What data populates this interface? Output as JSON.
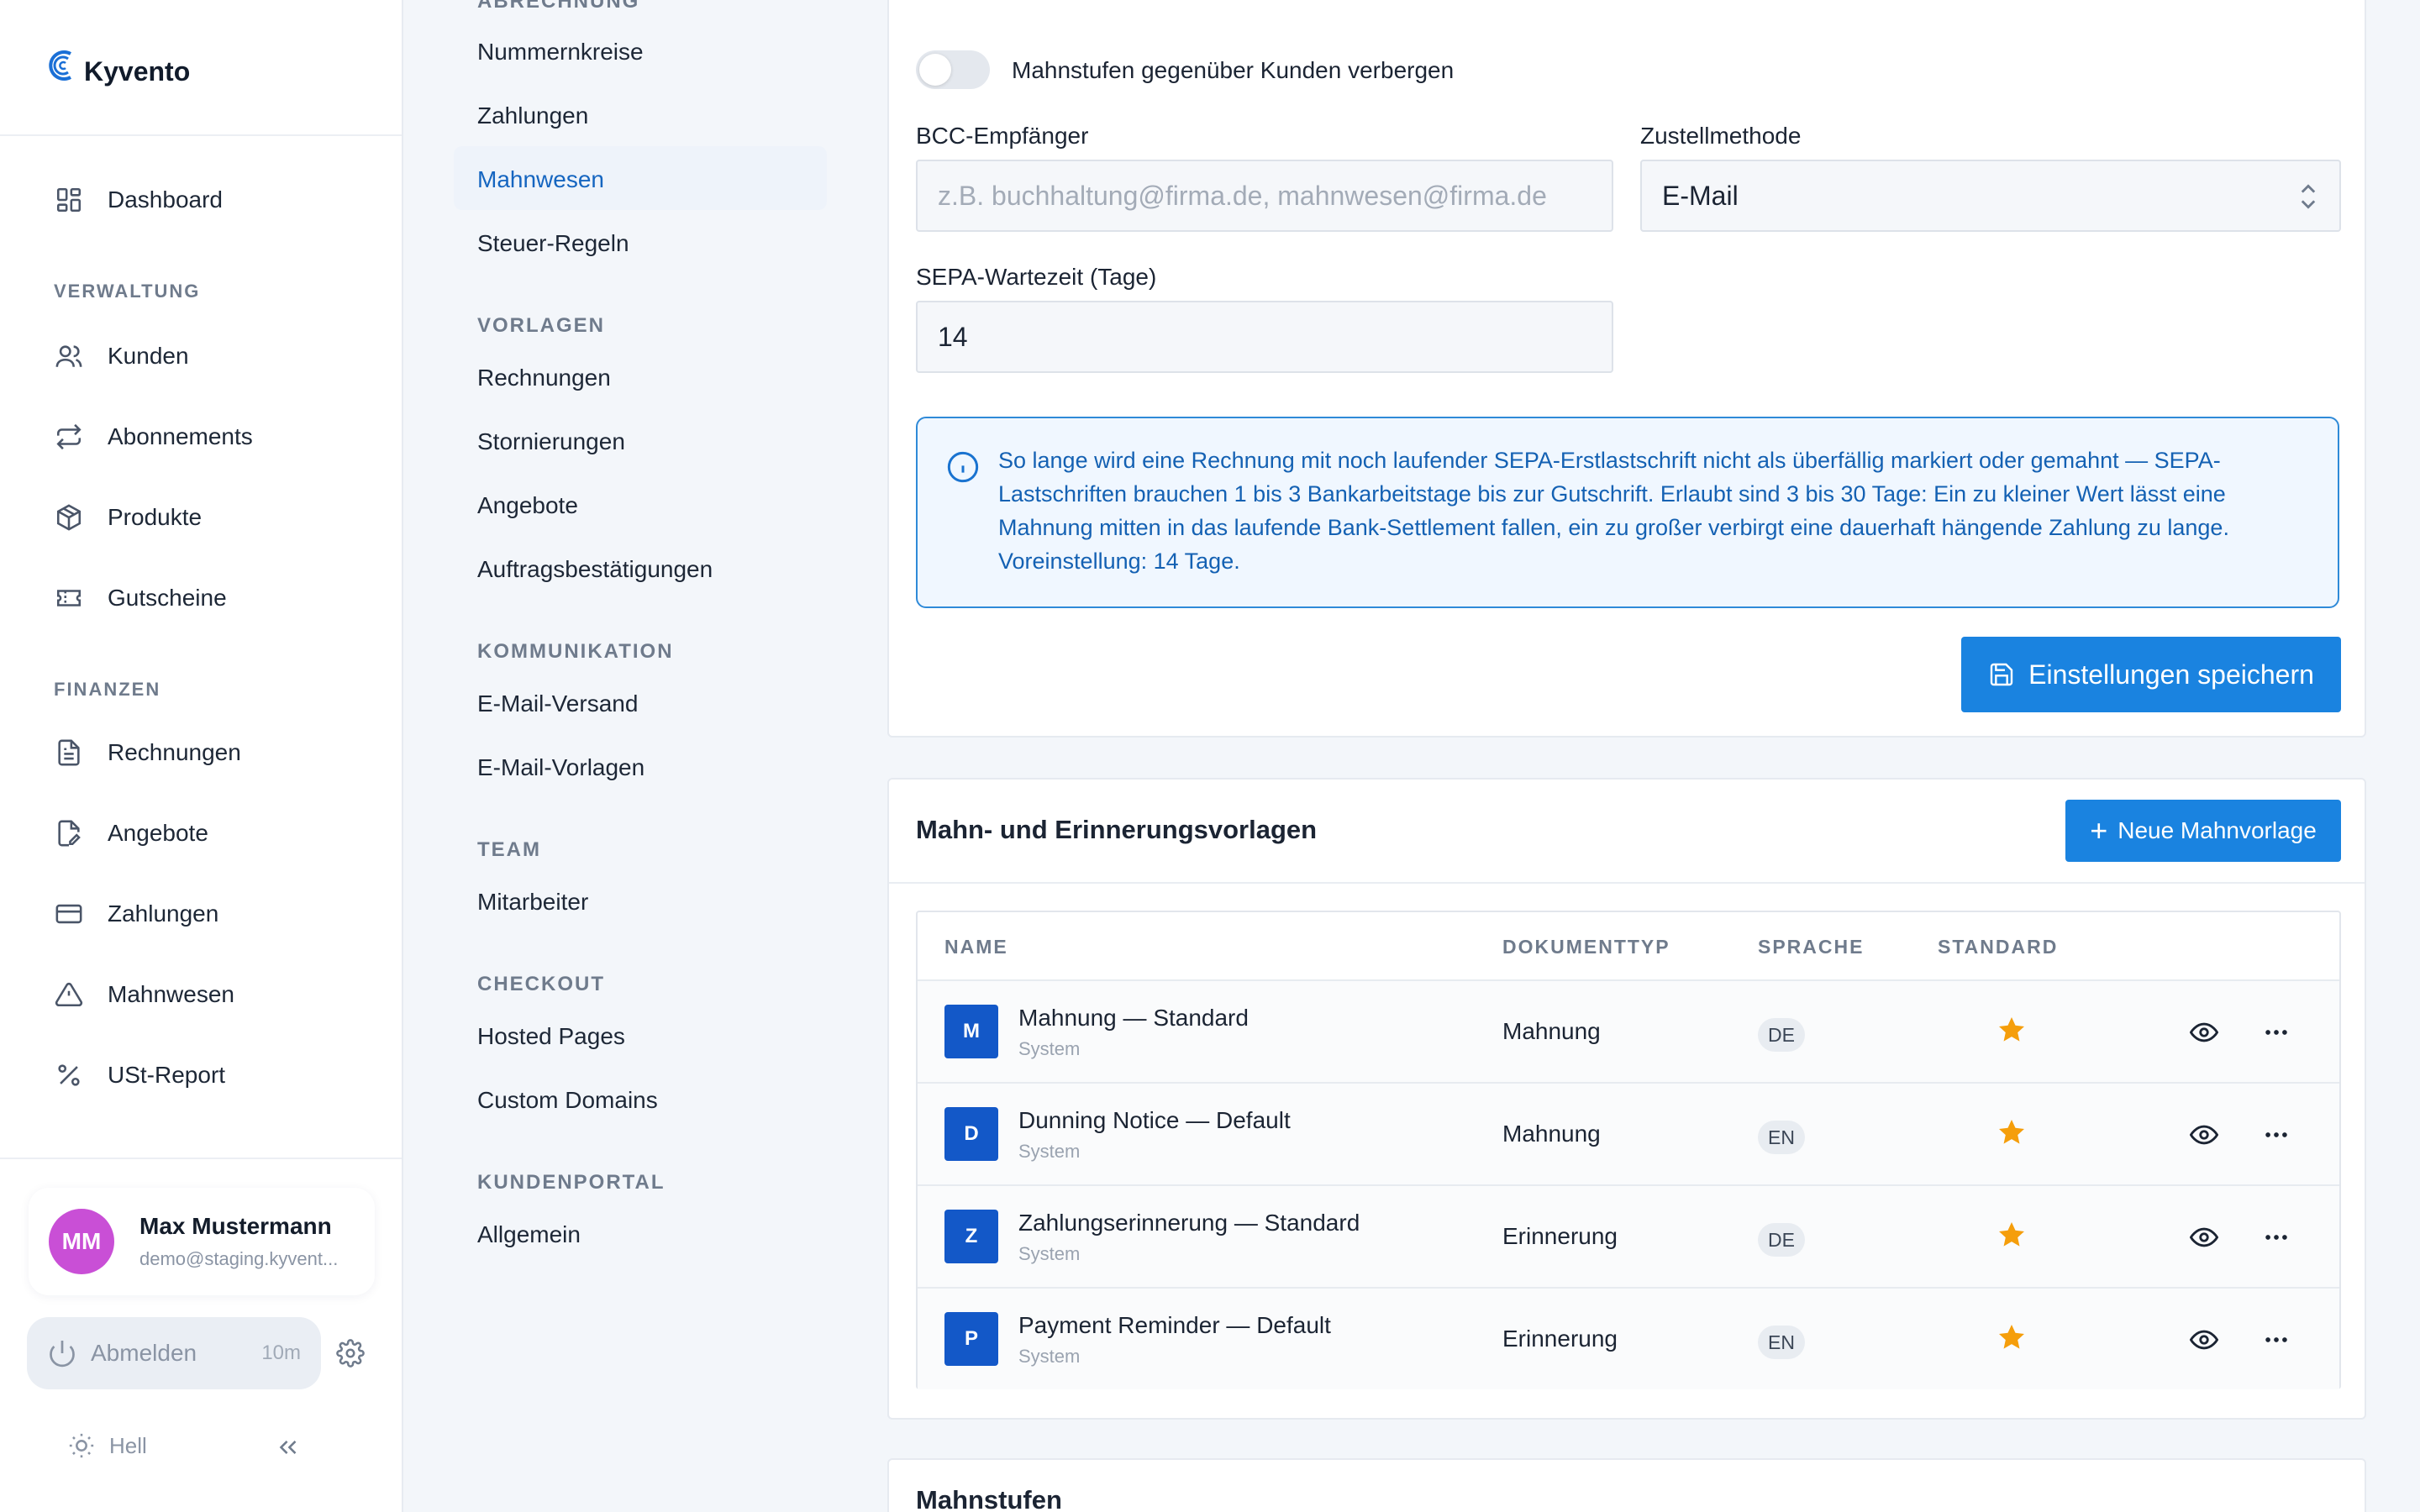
{
  "brand": {
    "name": "Kyvento"
  },
  "sidebar": {
    "dashboard": "Dashboard",
    "sections": {
      "verwaltung": "VERWALTUNG",
      "finanzen": "FINANZEN"
    },
    "verwaltung_items": [
      "Kunden",
      "Abonnements",
      "Produkte",
      "Gutscheine"
    ],
    "finanzen_items": [
      "Rechnungen",
      "Angebote",
      "Zahlungen",
      "Mahnwesen",
      "USt-Report"
    ]
  },
  "user": {
    "initials": "MM",
    "name": "Max Mustermann",
    "email": "demo@staging.kyvent...",
    "logout_label": "Abmelden",
    "session_timer": "10m",
    "theme_label": "Hell"
  },
  "subnav": {
    "partial_section": "ABRECHNUNG",
    "abrechnung": [
      "Nummernkreise",
      "Zahlungen",
      "Mahnwesen",
      "Steuer-Regeln"
    ],
    "active": "Mahnwesen",
    "vorlagen_label": "VORLAGEN",
    "vorlagen": [
      "Rechnungen",
      "Stornierungen",
      "Angebote",
      "Auftragsbestätigungen"
    ],
    "kommunikation_label": "KOMMUNIKATION",
    "kommunikation": [
      "E-Mail-Versand",
      "E-Mail-Vorlagen"
    ],
    "team_label": "TEAM",
    "team": [
      "Mitarbeiter"
    ],
    "checkout_label": "CHECKOUT",
    "checkout": [
      "Hosted Pages",
      "Custom Domains"
    ],
    "kundenportal_label": "KUNDENPORTAL",
    "kundenportal": [
      "Allgemein"
    ]
  },
  "settings": {
    "toggle_label": "Mahnstufen gegenüber Kunden verbergen",
    "toggle_on": false,
    "bcc_label": "BCC-Empfänger",
    "bcc_placeholder": "z.B. buchhaltung@firma.de, mahnwesen@firma.de",
    "delivery_label": "Zustellmethode",
    "delivery_value": "E-Mail",
    "sepa_label": "SEPA-Wartezeit (Tage)",
    "sepa_value": "14",
    "info_text": "So lange wird eine Rechnung mit noch laufender SEPA-Erstlastschrift nicht als überfällig markiert oder gemahnt — SEPA-Lastschriften brauchen 1 bis 3 Bankarbeitstage bis zur Gutschrift. Erlaubt sind 3 bis 30 Tage: Ein zu kleiner Wert lässt eine Mahnung mitten in das laufende Bank-Settlement fallen, ein zu großer verbirgt eine dauerhaft hängende Zahlung zu lange. Voreinstellung: 14 Tage.",
    "save_label": "Einstellungen speichern"
  },
  "templates": {
    "title": "Mahn- und Erinnerungsvorlagen",
    "new_label": "Neue Mahnvorlage",
    "columns": {
      "name": "NAME",
      "doctype": "DOKUMENTTYP",
      "language": "SPRACHE",
      "default": "STANDARD"
    },
    "rows": [
      {
        "initial": "M",
        "name": "Mahnung — Standard",
        "source": "System",
        "doctype": "Mahnung",
        "language": "DE",
        "is_default": true
      },
      {
        "initial": "D",
        "name": "Dunning Notice — Default",
        "source": "System",
        "doctype": "Mahnung",
        "language": "EN",
        "is_default": true
      },
      {
        "initial": "Z",
        "name": "Zahlungserinnerung — Standard",
        "source": "System",
        "doctype": "Erinnerung",
        "language": "DE",
        "is_default": true
      },
      {
        "initial": "P",
        "name": "Payment Reminder — Default",
        "source": "System",
        "doctype": "Erinnerung",
        "language": "EN",
        "is_default": true
      }
    ]
  },
  "steps": {
    "title": "Mahnstufen"
  },
  "colors": {
    "primary": "#1a83e0",
    "active_nav": "#1565c0",
    "star": "#f59e0b",
    "avatar": "#c94fd6",
    "info_border": "#2f8ad8"
  }
}
